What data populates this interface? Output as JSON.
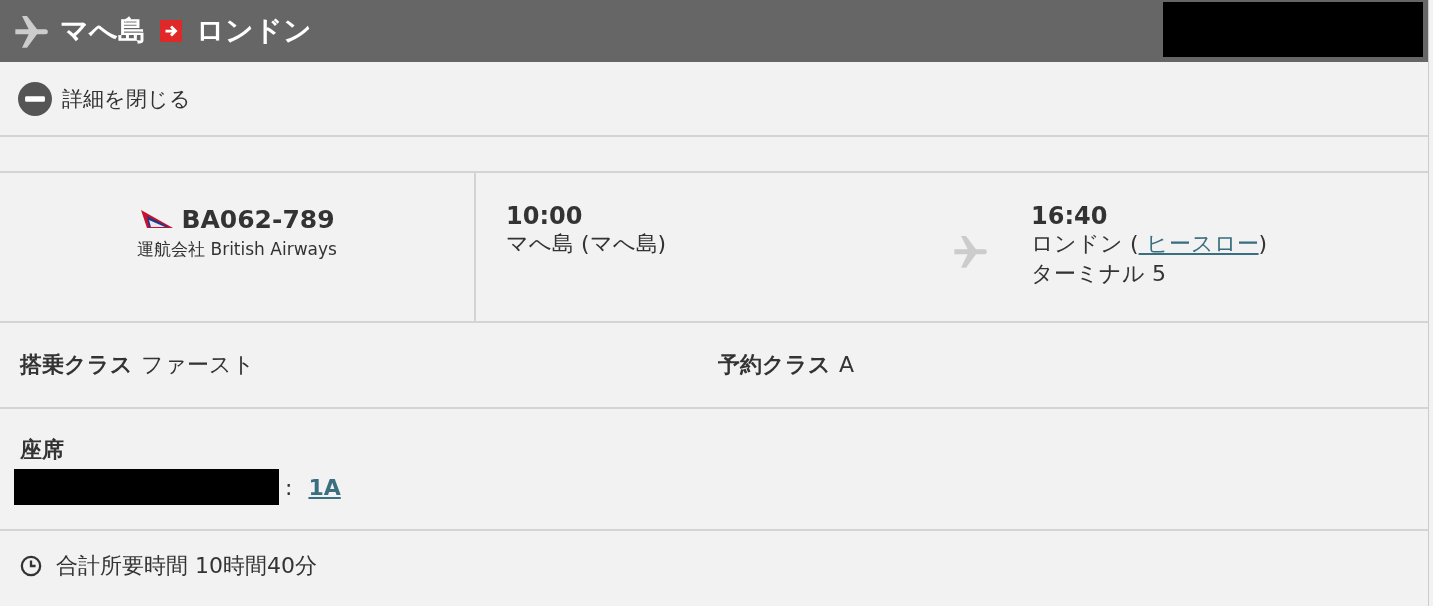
{
  "header": {
    "origin": "マへ島",
    "destination": "ロンドン",
    "redacted": true
  },
  "toggle": {
    "label": "詳細を閉じる",
    "expanded": true
  },
  "flight": {
    "number": "BA062-789",
    "operator": "運航会社 British Airways",
    "departure": {
      "time": "10:00",
      "place": "マへ島 (マへ島)"
    },
    "arrival": {
      "time": "16:40",
      "city": "ロンドン (",
      "airport": " ヒースロー",
      "close": ")",
      "terminal": "ターミナル  5"
    }
  },
  "classes": [
    {
      "label": "搭乗クラス",
      "value": "ファースト"
    },
    {
      "label": "予約クラス",
      "value": "A"
    }
  ],
  "seat": {
    "label": "座席",
    "redacted": true,
    "separator": ":",
    "value": "1A"
  },
  "total": {
    "label": "合計所要時間 10時間40分"
  }
}
